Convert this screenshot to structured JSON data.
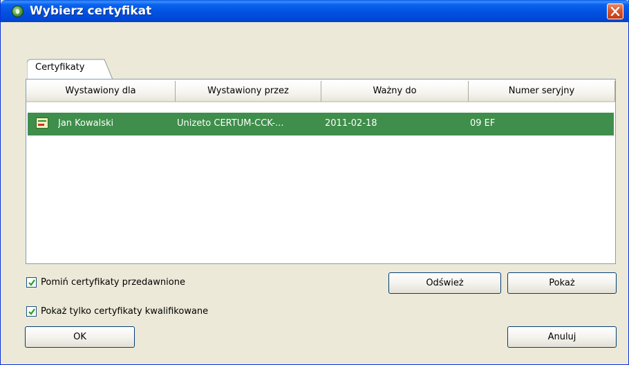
{
  "window": {
    "title": "Wybierz certyfikat"
  },
  "tabs": [
    {
      "label": "Certyfikaty",
      "selected": true
    }
  ],
  "table": {
    "columns": [
      "Wystawiony dla",
      "Wystawiony przez",
      "Ważny do",
      "Numer seryjny"
    ],
    "rows": [
      {
        "issued_to": "Jan Kowalski",
        "issued_by": "Unizeto CERTUM-CCK-...",
        "valid_to": "2011-02-18",
        "serial": "09 EF",
        "selected": true
      }
    ]
  },
  "options": {
    "skip_expired": {
      "label": "Pomiń certyfikaty przedawnione",
      "checked": true
    },
    "qualified_only": {
      "label": "Pokaż tylko certyfikaty kwalifikowane",
      "checked": true
    }
  },
  "buttons": {
    "refresh": "Odśwież",
    "show": "Pokaż",
    "ok": "OK",
    "cancel": "Anuluj"
  },
  "colors": {
    "titlebar": "#0453e0",
    "selection": "#3f8e4b",
    "close_button": "#d9552e",
    "check_mark": "#21a121"
  }
}
